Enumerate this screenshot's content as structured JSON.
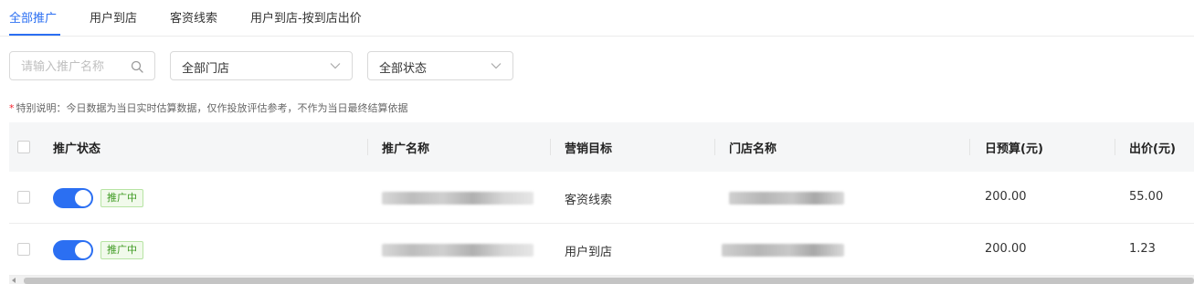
{
  "tabs": [
    {
      "label": "全部推广",
      "active": true
    },
    {
      "label": "用户到店",
      "active": false
    },
    {
      "label": "客资线索",
      "active": false
    },
    {
      "label": "用户到店-按到店出价",
      "active": false
    }
  ],
  "filters": {
    "search_placeholder": "请输入推广名称",
    "store_select": "全部门店",
    "status_select": "全部状态"
  },
  "note": {
    "star": "*",
    "text": "特别说明：今日数据为当日实时估算数据，仅作投放评估参考，不作为当日最终结算依据"
  },
  "table": {
    "headers": {
      "status": "推广状态",
      "name": "推广名称",
      "goal": "营销目标",
      "store": "门店名称",
      "budget": "日预算(元)",
      "bid": "出价(元)"
    },
    "rows": [
      {
        "status_badge": "推广中",
        "toggle_on": true,
        "goal": "客资线索",
        "budget": "200.00",
        "bid": "55.00"
      },
      {
        "status_badge": "推广中",
        "toggle_on": true,
        "goal": "用户到店",
        "budget": "200.00",
        "bid": "1.23"
      }
    ]
  },
  "colors": {
    "accent": "#2b6ff2",
    "badge_text": "#3e9a22",
    "badge_bg": "#f1faeb",
    "header_bg": "#f5f6f7"
  }
}
